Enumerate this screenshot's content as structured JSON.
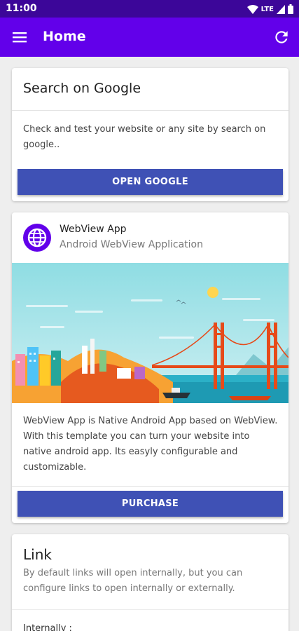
{
  "status_bar": {
    "time": "11:00",
    "network": "LTE"
  },
  "app_bar": {
    "title": "Home"
  },
  "google_card": {
    "title": "Search on Google",
    "description": "Check and test your website or any site by search on google..",
    "button": "OPEN GOOGLE"
  },
  "app_card": {
    "name": "WebView App",
    "subtitle": "Android WebView Application",
    "description": "WebView App is Native Android App based on WebView. With this template you can turn your website into native android app. Its easyly configurable and customizable.",
    "button": "PURCHASE"
  },
  "link_card": {
    "title": "Link",
    "description": "By default links will open internally, but you can configure links to open internally or externally.",
    "internally_label": "Internally :"
  },
  "colors": {
    "status_bar": "#3c0699",
    "app_bar": "#6200ea",
    "button": "#3f51b5"
  }
}
